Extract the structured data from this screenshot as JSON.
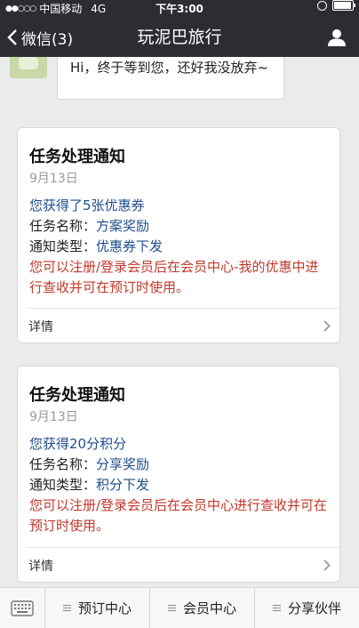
{
  "status": {
    "carrier": "中国移动",
    "network": "4G",
    "time": "下午3:00"
  },
  "nav": {
    "back_label": "微信(3)",
    "title": "玩泥巴旅行"
  },
  "prev_message": {
    "text": "Hi，终于等到您，还好我没放弃~"
  },
  "cards": [
    {
      "title": "任务处理通知",
      "date": "9月13日",
      "headline": "您获得了5张优惠券",
      "task_label": "任务名称：",
      "task_value": "方案奖励",
      "type_label": "通知类型：",
      "type_value": "优惠券下发",
      "note": "您可以注册/登录会员后在会员中心-我的优惠中进行查收并可在预订时使用。",
      "detail": "详情"
    },
    {
      "title": "任务处理通知",
      "date": "9月13日",
      "headline": "您获得20分积分",
      "task_label": "任务名称：",
      "task_value": "分享奖励",
      "type_label": "通知类型：",
      "type_value": "积分下发",
      "note": "您可以注册/登录会员后在会员中心进行查收并可在预订时使用。",
      "detail": "详情"
    }
  ],
  "menu": {
    "items": [
      "预订中心",
      "会员中心",
      "分享伙伴"
    ]
  }
}
